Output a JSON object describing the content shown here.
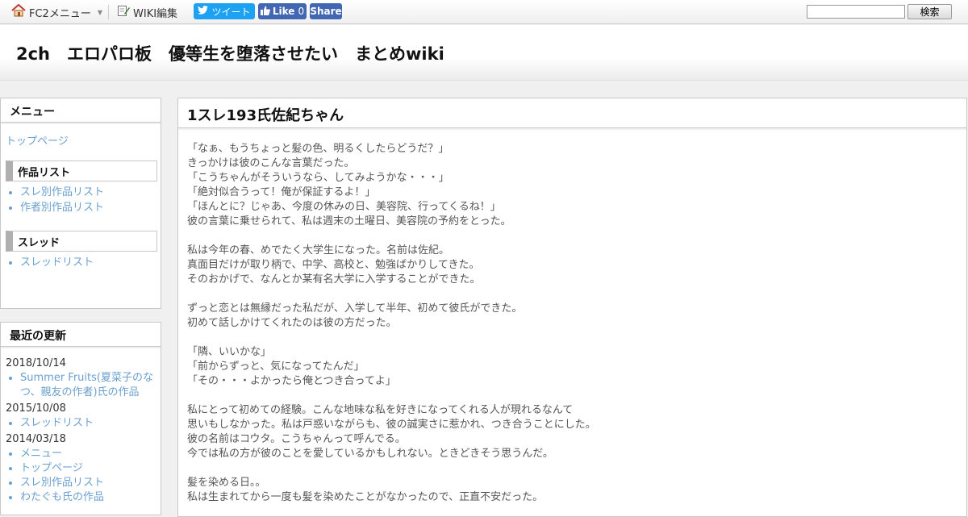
{
  "toolbar": {
    "fc2_menu_label": "FC2メニュー",
    "wiki_edit_label": "WIKI編集",
    "tweet_label": "ツイート",
    "like_label": "Like",
    "like_count": "0",
    "share_label": "Share",
    "search_placeholder": "",
    "search_button_label": "検索"
  },
  "header": {
    "site_title": "2ch　エロパロ板　優等生を堕落させたい　まとめwiki"
  },
  "sidebar": {
    "menu_title": "メニュー",
    "top_page_link": "トップページ",
    "works_heading": "作品リスト",
    "works_links": [
      "スレ別作品リスト",
      "作者別作品リスト"
    ],
    "thread_heading": "スレッド",
    "thread_links": [
      "スレッドリスト"
    ],
    "recent_title": "最近の更新",
    "recent": [
      {
        "date": "2018/10/14",
        "items": [
          "Summer Fruits(夏菜子のなつ、親友の作者)氏の作品"
        ]
      },
      {
        "date": "2015/10/08",
        "items": [
          "スレッドリスト"
        ]
      },
      {
        "date": "2014/03/18",
        "items": [
          "メニュー",
          "トップページ",
          "スレ別作品リスト",
          "わたぐも氏の作品"
        ]
      }
    ]
  },
  "article": {
    "title": "1スレ193氏佐紀ちゃん",
    "lines": [
      "「なぁ、もうちょっと髪の色、明るくしたらどうだ？」",
      "きっかけは彼のこんな言葉だった。",
      "「こうちゃんがそういうなら、してみようかな・・・」",
      "「絶対似合うって！俺が保証するよ！」",
      "「ほんとに？じゃあ、今度の休みの日、美容院、行ってくるね！」",
      "彼の言葉に乗せられて、私は週末の土曜日、美容院の予約をとった。",
      "",
      "私は今年の春、めでたく大学生になった。名前は佐紀。",
      "真面目だけが取り柄で、中学、高校と、勉強ばかりしてきた。",
      "そのおかげで、なんとか某有名大学に入学することができた。",
      "",
      "ずっと恋とは無縁だった私だが、入学して半年、初めて彼氏ができた。",
      "初めて話しかけてくれたのは彼の方だった。",
      "",
      "「隣、いいかな」",
      "「前からずっと、気になってたんだ」",
      "「その・・・よかったら俺とつき合ってよ」",
      "",
      "私にとって初めての経験。こんな地味な私を好きになってくれる人が現れるなんて",
      "思いもしなかった。私は戸惑いながらも、彼の誠実さに惹かれ、つき合うことにした。",
      "彼の名前はコウタ。こうちゃんって呼んでる。",
      "今では私の方が彼のことを愛しているかもしれない。ときどきそう思うんだ。",
      "",
      "髪を染める日。。",
      "私は生まれてから一度も髪を染めたことがなかったので、正直不安だった。"
    ]
  },
  "colors": {
    "link": "#6a9fd0",
    "tweet": "#1da1f2",
    "facebook": "#4267b2"
  },
  "icons": {
    "fc2_menu": "home-icon",
    "wiki_edit": "edit-icon",
    "tweet": "twitter-bird-icon",
    "like": "thumbs-up-icon"
  }
}
